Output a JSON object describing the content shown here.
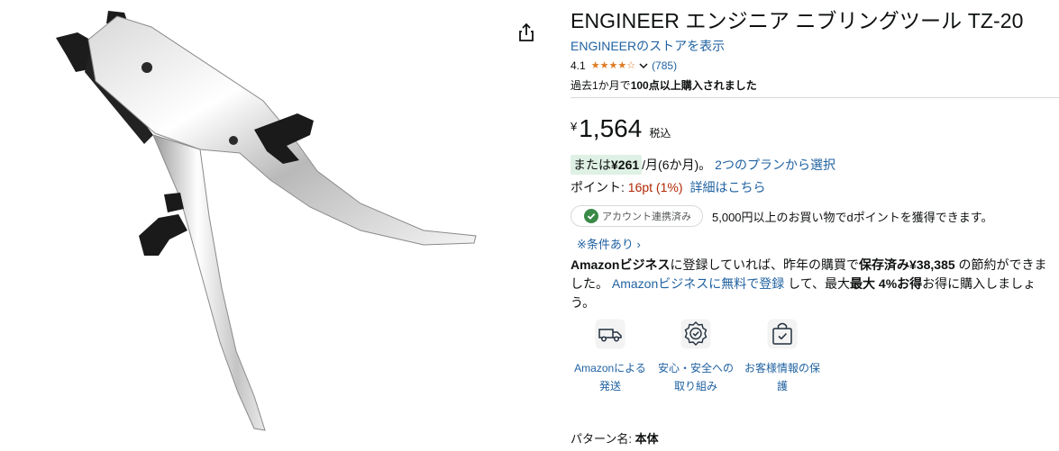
{
  "product": {
    "title": "ENGINEER エンジニア ニブリングツール TZ-20",
    "store_link": "ENGINEERのストアを表示",
    "rating_value": "4.1",
    "rating_count": "(785)",
    "bought_prefix": "過去1か月で",
    "bought_bold": "100点以上購入されました"
  },
  "price": {
    "currency": "¥",
    "amount": "1,564",
    "tax_label": "税込"
  },
  "installment": {
    "prefix": "または",
    "amount": "¥261",
    "suffix": "/月(6か月)。",
    "link": "2つのプランから選択"
  },
  "points": {
    "label": "ポイント: ",
    "value": "16pt (1%)",
    "link": "詳細はこちら"
  },
  "account": {
    "pill_label": "アカウント連携済み",
    "text": "5,000円以上のお買い物でdポイントを獲得できます。",
    "conditions_link": "※条件あり ›"
  },
  "business": {
    "part1": "Amazonビジネス",
    "part2": "に登録していれば、昨年の購買で",
    "part3": "保存済み¥38,385",
    "part4": " の節約ができました。 ",
    "link": "Amazonビジネスに無料で登録",
    "part5": " して、最大",
    "part6": "最大 4%お得",
    "part7": "お得に購入しましょう。"
  },
  "features": [
    {
      "label": "Amazonによる発送",
      "icon": "delivery-truck-icon"
    },
    {
      "label": "安心・安全への取り組み",
      "icon": "safety-badge-icon"
    },
    {
      "label": "お客様情報の保護",
      "icon": "secure-bag-icon"
    }
  ],
  "pattern": {
    "label": "パターン名: ",
    "value": "本体"
  },
  "colors": {
    "link": "#2162a1",
    "star": "#de7921",
    "points": "#b12704",
    "installment_bg": "#dff0e4",
    "check_green": "#3a8a47"
  }
}
